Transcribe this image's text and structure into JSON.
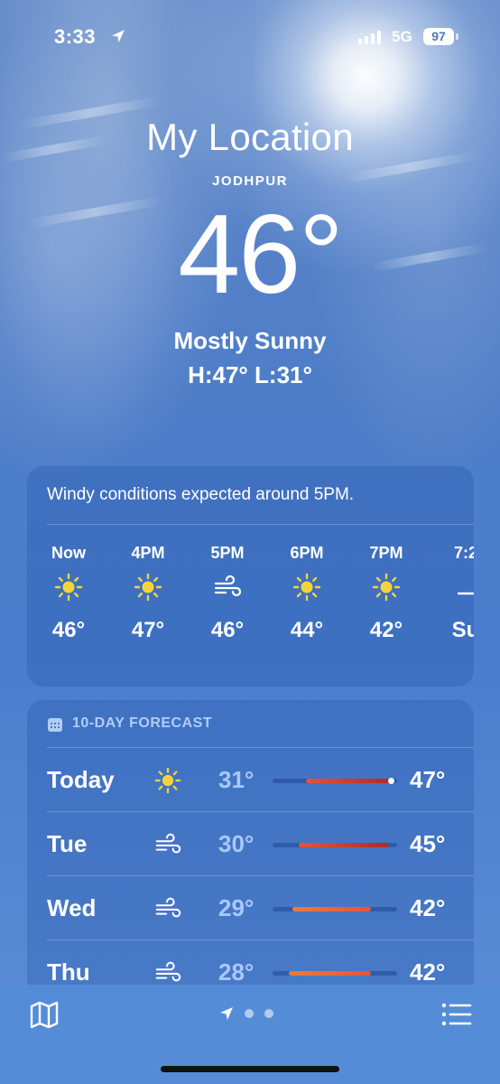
{
  "status_bar": {
    "time": "3:33",
    "network": "5G",
    "battery": "97"
  },
  "header": {
    "title": "My Location",
    "city": "JODHPUR",
    "temperature": "46°",
    "condition": "Mostly Sunny",
    "high_low": "H:47°  L:31°"
  },
  "hourly": {
    "summary": "Windy conditions expected around 5PM.",
    "hours": [
      {
        "label": "Now",
        "icon": "sun-icon",
        "temp": "46°"
      },
      {
        "label": "4PM",
        "icon": "sun-icon",
        "temp": "47°"
      },
      {
        "label": "5PM",
        "icon": "wind-icon",
        "temp": "46°"
      },
      {
        "label": "6PM",
        "icon": "sun-icon",
        "temp": "44°"
      },
      {
        "label": "7PM",
        "icon": "sun-icon",
        "temp": "42°"
      },
      {
        "label": "7:2",
        "icon": "sunset-icon",
        "temp": "Su"
      }
    ]
  },
  "forecast": {
    "header": "10-DAY FORECAST",
    "days": [
      {
        "name": "Today",
        "icon": "sun-icon",
        "low": "31°",
        "high": "47°",
        "range_start": 0.27,
        "range_end": 0.95,
        "current": 0.95
      },
      {
        "name": "Tue",
        "icon": "wind-icon",
        "low": "30°",
        "high": "45°",
        "range_start": 0.21,
        "range_end": 0.93
      },
      {
        "name": "Wed",
        "icon": "wind-icon",
        "low": "29°",
        "high": "42°",
        "range_start": 0.16,
        "range_end": 0.79
      },
      {
        "name": "Thu",
        "icon": "wind-icon",
        "low": "28°",
        "high": "42°",
        "range_start": 0.13,
        "range_end": 0.79
      }
    ]
  },
  "colors": {
    "sun": "#f6d33a",
    "bar_warm": "#e2553c",
    "bar_hot": "#b02a26",
    "bar_orange": "#f07a3a"
  }
}
